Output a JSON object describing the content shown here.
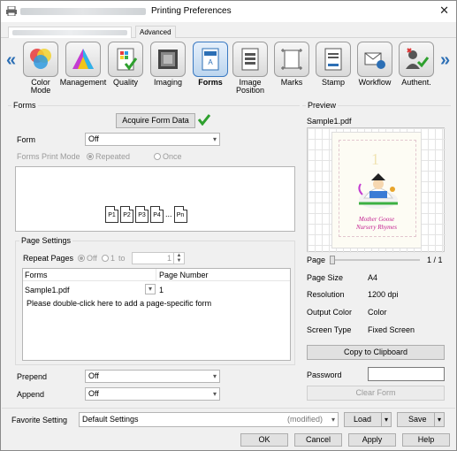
{
  "window": {
    "title": "Printing Preferences",
    "close_glyph": "✕"
  },
  "tabs": {
    "advanced": "Advanced"
  },
  "functions": [
    {
      "id": "color-mode",
      "label": "Color\nMode"
    },
    {
      "id": "management",
      "label": "Management"
    },
    {
      "id": "quality",
      "label": "Quality"
    },
    {
      "id": "imaging",
      "label": "Imaging"
    },
    {
      "id": "forms",
      "label": "Forms",
      "selected": true
    },
    {
      "id": "image-position",
      "label": "Image\nPosition"
    },
    {
      "id": "marks",
      "label": "Marks"
    },
    {
      "id": "stamp",
      "label": "Stamp"
    },
    {
      "id": "workflow",
      "label": "Workflow"
    },
    {
      "id": "authent",
      "label": "Authent."
    }
  ],
  "nav": {
    "left": "«",
    "right": "»"
  },
  "forms": {
    "section": "Forms",
    "acquire_button": "Acquire Form Data",
    "form_label": "Form",
    "form_value": "Off",
    "print_mode_label": "Forms Print Mode",
    "mode_repeated": "Repeated",
    "mode_once": "Once",
    "pages": [
      "P1",
      "P2",
      "P3",
      "P4",
      "...",
      "Pn"
    ]
  },
  "page_settings": {
    "title": "Page Settings",
    "repeat_label": "Repeat Pages",
    "off": "Off",
    "range_from": "1",
    "to": "to",
    "range_to": "1",
    "col_forms": "Forms",
    "col_page": "Page Number",
    "row_form": "Sample1.pdf",
    "row_page": "1",
    "hint": "Please double-click here to add a page-specific form"
  },
  "prepend": {
    "label": "Prepend",
    "value": "Off"
  },
  "append": {
    "label": "Append",
    "value": "Off"
  },
  "preview": {
    "section": "Preview",
    "file": "Sample1.pdf",
    "page_label": "Page",
    "page_count": "1 / 1",
    "page_number": "1",
    "art_title_1": "Mother Goose",
    "art_title_2": "Nursery Rhymes",
    "info": [
      {
        "k": "Page Size",
        "v": "A4"
      },
      {
        "k": "Resolution",
        "v": "1200 dpi"
      },
      {
        "k": "Output Color",
        "v": "Color"
      },
      {
        "k": "Screen Type",
        "v": "Fixed Screen"
      }
    ],
    "copy_button": "Copy to Clipboard",
    "password_label": "Password",
    "clear_button": "Clear Form"
  },
  "favorite": {
    "label": "Favorite Setting",
    "value": "Default Settings",
    "modified": "(modified)",
    "load": "Load",
    "save": "Save"
  },
  "footer": {
    "ok": "OK",
    "cancel": "Cancel",
    "apply": "Apply",
    "help": "Help"
  },
  "colors": {
    "accent": "#2c6fb5",
    "check": "#2ea02e",
    "selected_tab": "#3a79c2"
  }
}
